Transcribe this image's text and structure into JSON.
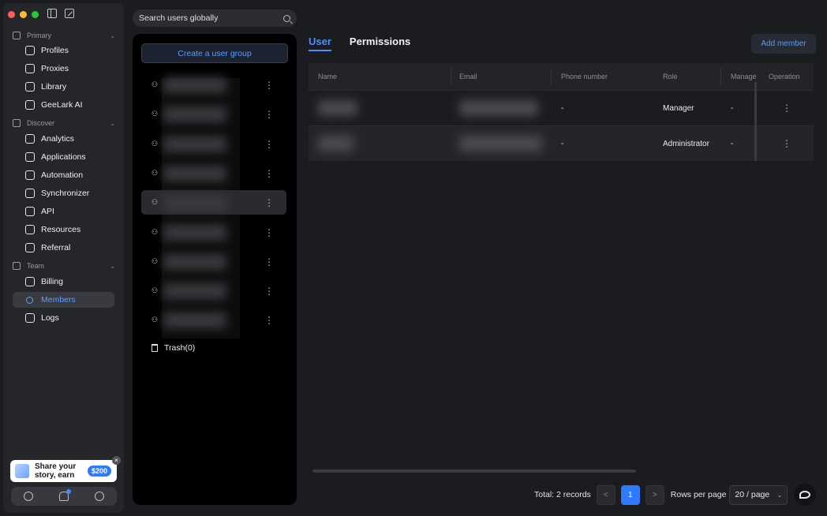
{
  "sidebar": {
    "sections": [
      {
        "label": "Primary",
        "icon": "home-icon",
        "items": [
          {
            "label": "Profiles",
            "icon": "profiles-icon"
          },
          {
            "label": "Proxies",
            "icon": "proxies-icon"
          },
          {
            "label": "Library",
            "icon": "library-icon"
          },
          {
            "label": "GeeLark AI",
            "icon": "ai-icon"
          }
        ]
      },
      {
        "label": "Discover",
        "icon": "eye-icon",
        "items": [
          {
            "label": "Analytics",
            "icon": "analytics-icon"
          },
          {
            "label": "Applications",
            "icon": "applications-icon"
          },
          {
            "label": "Automation",
            "icon": "automation-icon"
          },
          {
            "label": "Synchronizer",
            "icon": "synchronizer-icon"
          },
          {
            "label": "API",
            "icon": "api-icon"
          },
          {
            "label": "Resources",
            "icon": "resources-icon"
          },
          {
            "label": "Referral",
            "icon": "referral-icon"
          }
        ]
      },
      {
        "label": "Team",
        "icon": "team-icon",
        "items": [
          {
            "label": "Billing",
            "icon": "billing-icon"
          },
          {
            "label": "Members",
            "icon": "members-icon"
          },
          {
            "label": "Logs",
            "icon": "logs-icon"
          }
        ]
      }
    ],
    "active_item": "Members",
    "promo": {
      "line1": "Share your",
      "line2": "story, earn",
      "badge": "$200"
    }
  },
  "search": {
    "placeholder": "Search users globally"
  },
  "groups": {
    "create_label": "Create a user group",
    "count": 9,
    "active_index": 4,
    "trash_label": "Trash(0)"
  },
  "tabs": [
    {
      "label": "User",
      "active": true
    },
    {
      "label": "Permissions",
      "active": false
    }
  ],
  "add_member_label": "Add member",
  "table": {
    "columns": [
      "Name",
      "Email",
      "Phone number",
      "Role",
      "Manage",
      "Operation"
    ],
    "rows": [
      {
        "phone": "-",
        "role": "Manager",
        "manage": "-"
      },
      {
        "phone": "-",
        "role": "Administrator",
        "manage": "-"
      }
    ]
  },
  "pagination": {
    "total": "Total: 2 records",
    "current_page": "1",
    "rows_label": "Rows per page",
    "rows_value": "20 / page"
  },
  "colors": {
    "accent": "#2f7bff",
    "background": "#1b1c1f"
  }
}
